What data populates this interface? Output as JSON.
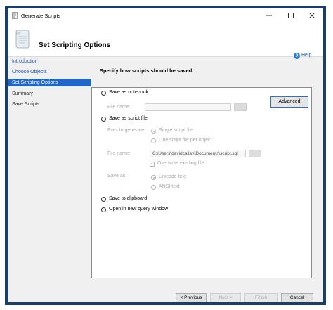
{
  "window": {
    "title": "Generate Scripts"
  },
  "header": {
    "title": "Set Scripting Options"
  },
  "help": {
    "label": "Help"
  },
  "nav": {
    "items": [
      {
        "label": "Introduction",
        "state": "link"
      },
      {
        "label": "Choose Objects",
        "state": "link"
      },
      {
        "label": "Set Scripting Options",
        "state": "active"
      },
      {
        "label": "Summary",
        "state": "disabled"
      },
      {
        "label": "Save Scripts",
        "state": "disabled"
      }
    ]
  },
  "content": {
    "heading": "Specify how scripts should be saved."
  },
  "options": {
    "notebook": {
      "label": "Save as notebook",
      "file_name_label": "File name:",
      "file_name_value": ""
    },
    "script_file": {
      "label": "Save as script file",
      "files_to_generate_label": "Files to generate:",
      "single_file_label": "Single script file",
      "per_object_label": "One script file per object",
      "file_name_label": "File name:",
      "file_name_value": "C:\\Users\\davidcallan\\Documents\\script.sql",
      "overwrite_label": "Overwrite existing file",
      "save_as_label": "Save as:",
      "unicode_label": "Unicode text",
      "ansi_label": "ANSI text"
    },
    "clipboard": {
      "label": "Save to clipboard"
    },
    "query_window": {
      "label": "Open in new query window"
    },
    "advanced_button": "Advanced"
  },
  "footer": {
    "previous": "< Previous",
    "next": "Next >",
    "finish": "Finish",
    "cancel": "Cancel"
  },
  "colors": {
    "accent": "#2066c8",
    "frame": "#1d3f66",
    "link": "#1a56b5"
  }
}
